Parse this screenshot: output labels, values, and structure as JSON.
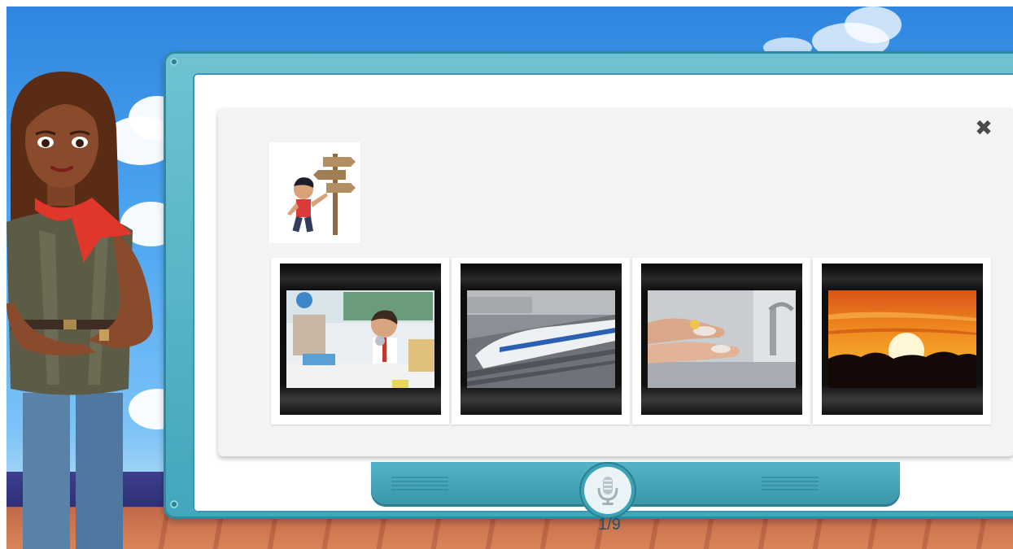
{
  "dialog": {
    "close_label": "✖"
  },
  "options": [
    {
      "id": "classroom",
      "icon": "classroom-photo"
    },
    {
      "id": "train",
      "icon": "bullet-train-photo"
    },
    {
      "id": "handwashing",
      "icon": "hand-washing-photo"
    },
    {
      "id": "sunset",
      "icon": "sunset-photo"
    }
  ],
  "prompt_picture": {
    "icon": "boy-with-signpost-illustration"
  },
  "footer": {
    "mic_icon": "microphone-icon",
    "page_counter": "1/9"
  },
  "colors": {
    "sky": "#52a9f2",
    "monitor_frame": "#43a6bb",
    "dialog_bg": "#f4f3f1",
    "close_icon": "#4a4a4a",
    "counter_text": "#20536a"
  }
}
